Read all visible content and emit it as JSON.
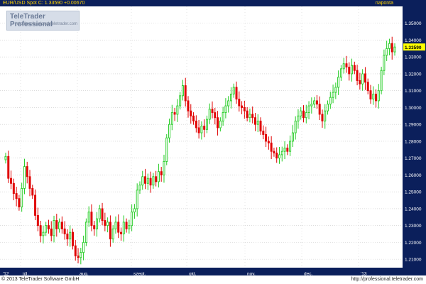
{
  "header": {
    "symbol_label": "EUR/USD Spot C: 1.33590 +0.00670",
    "timeframe_label": "naponta"
  },
  "logo": {
    "title": "TeleTrader Professional",
    "url": "http://professional.teletrader.com"
  },
  "footer": {
    "copyright": "© 2013 TeleTrader Software GmbH",
    "url": "http://professional.teletrader.com"
  },
  "colors": {
    "up": "#22cc22",
    "down": "#e00000",
    "axis_bg": "#0b1f5b",
    "grid": "#c8c8c8",
    "price_tag": "#ffff00"
  },
  "chart_data": {
    "type": "candlestick",
    "title": "EUR/USD Spot",
    "last_price": 1.3359,
    "change": 0.0067,
    "ylim": [
      1.205,
      1.36
    ],
    "yticks": [
      "1.21000",
      "1.22000",
      "1.23000",
      "1.24000",
      "1.25000",
      "1.26000",
      "1.27000",
      "1.28000",
      "1.29000",
      "1.30000",
      "1.31000",
      "1.32000",
      "1.33000",
      "1.34000",
      "1.35000"
    ],
    "xticks": [
      "'12",
      "júl.",
      "aug.",
      "szept.",
      "okt.",
      "nov.",
      "dec.",
      "'13"
    ],
    "closes": [
      1.271,
      1.258,
      1.255,
      1.249,
      1.246,
      1.241,
      1.252,
      1.265,
      1.259,
      1.252,
      1.248,
      1.236,
      1.23,
      1.224,
      1.226,
      1.23,
      1.228,
      1.224,
      1.233,
      1.228,
      1.232,
      1.228,
      1.225,
      1.222,
      1.226,
      1.218,
      1.212,
      1.211,
      1.214,
      1.22,
      1.232,
      1.238,
      1.23,
      1.228,
      1.234,
      1.24,
      1.233,
      1.23,
      1.232,
      1.222,
      1.228,
      1.232,
      1.226,
      1.225,
      1.232,
      1.228,
      1.23,
      1.238,
      1.24,
      1.251,
      1.254,
      1.259,
      1.255,
      1.258,
      1.254,
      1.259,
      1.256,
      1.262,
      1.26,
      1.268,
      1.282,
      1.29,
      1.297,
      1.296,
      1.301,
      1.307,
      1.313,
      1.304,
      1.298,
      1.295,
      1.292,
      1.288,
      1.285,
      1.289,
      1.287,
      1.293,
      1.299,
      1.297,
      1.294,
      1.288,
      1.292,
      1.297,
      1.301,
      1.304,
      1.308,
      1.312,
      1.305,
      1.301,
      1.3,
      1.298,
      1.294,
      1.296,
      1.294,
      1.29,
      1.292,
      1.286,
      1.284,
      1.28,
      1.279,
      1.274,
      1.273,
      1.27,
      1.272,
      1.274,
      1.276,
      1.274,
      1.28,
      1.285,
      1.292,
      1.295,
      1.298,
      1.294,
      1.297,
      1.301,
      1.302,
      1.304,
      1.302,
      1.296,
      1.292,
      1.298,
      1.302,
      1.306,
      1.309,
      1.312,
      1.318,
      1.323,
      1.326,
      1.324,
      1.32,
      1.325,
      1.322,
      1.316,
      1.314,
      1.32,
      1.315,
      1.31,
      1.305,
      1.308,
      1.304,
      1.31,
      1.322,
      1.331,
      1.335,
      1.338,
      1.333,
      1.3359
    ]
  }
}
